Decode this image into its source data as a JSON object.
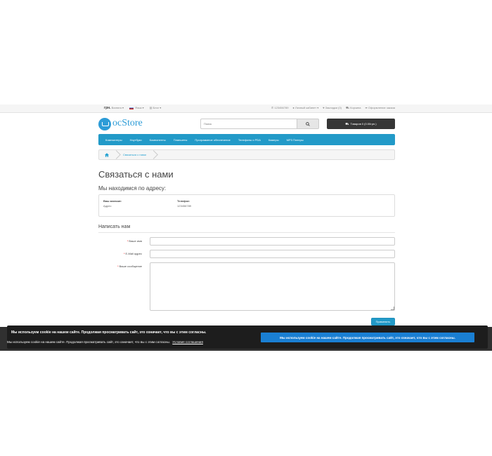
{
  "topbar": {
    "currency": "грн.",
    "currency_label": "Валюта",
    "language_label": "Язык",
    "blog_label": "Блог",
    "phone": "123456789",
    "account": "Личный кабинет",
    "wishlist": "Закладки (0)",
    "cart": "Корзина",
    "checkout": "Оформление заказа"
  },
  "logo": {
    "text": "ocStore",
    "subtitle": ""
  },
  "search": {
    "placeholder": "Поиск"
  },
  "cart_button": {
    "label": "Товаров 0 (0.00грн.)"
  },
  "menu": {
    "items": [
      "Компьютеры",
      "Ноутбуки",
      "Компоненты",
      "Планшеты",
      "Программное обеспечение",
      "Телефоны и PDA",
      "Камеры",
      "MP3 Плееры"
    ]
  },
  "breadcrumb": {
    "current": "Связаться с нами"
  },
  "page": {
    "title": "Связаться с нами",
    "address_heading": "Мы находимся по адресу:"
  },
  "store_info": {
    "name_label": "Ваш магазин",
    "address": "Адрес",
    "phone_label": "Телефон",
    "phone": "123456789"
  },
  "form": {
    "legend": "Написать нам",
    "name_label": "Ваше имя",
    "email_label": "E-Mail адрес",
    "message_label": "Ваше сообщение",
    "submit": "Применить"
  },
  "cookie": {
    "message": "Мы используем cookie на нашем сайте. Продолжая просматривать сайт, это означает, что вы с этим согласны.",
    "accept_button": "Мы используем cookie на нашем сайте. Продолжая просматривать сайт, это означает, что вы с этим согласны.",
    "small_message": "Мы используем cookie на нашем сайте. Продолжая просматривать сайт, это означает, что вы с этим согласны.",
    "policy_link": "Условия соглашения"
  },
  "colors": {
    "accent": "#229ac8",
    "cart_bg": "#363636",
    "cookie_bg": "#1d1d1d",
    "cookie_button": "#1a7fd3"
  }
}
